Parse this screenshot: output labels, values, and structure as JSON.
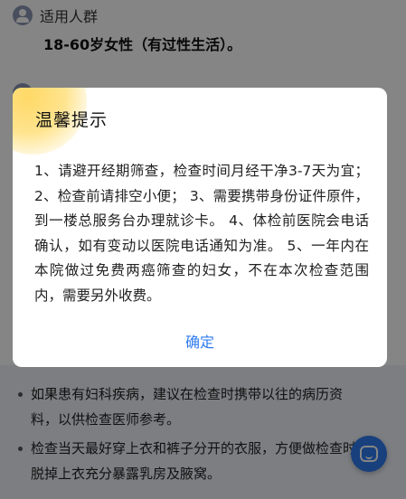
{
  "page": {
    "section_title": "适用人群",
    "target_audience": "18-60岁女性（有过性生活）。",
    "notes": [
      "如果患有妇科疾病，建议在检查时携带以往的病历资料，以供检查医师参考。",
      "检查当天最好穿上衣和裤子分开的衣服，方便做检查时脱掉上衣充分暴露乳房及腋窝。"
    ]
  },
  "dialog": {
    "title": "温馨提示",
    "body": "1、请避开经期筛查，检查时间月经干净3-7天为宜； 2、检查前请排空小便； 3、需要携带身份证件原件，到一楼总服务台办理就诊卡。 4、体检前医院会电话确认，如有变动以医院电话通知为准。 5、一年内在本院做过免费两癌筛查的妇女，不在本次检查范围内，需要另外收费。",
    "confirm_label": "确定"
  },
  "icons": {
    "section": "people-icon",
    "fab": "chat-icon"
  },
  "colors": {
    "accent": "#2f7bf0",
    "mask": "rgba(0,0,0,0.48)",
    "notes_background": "#eef1f8",
    "decoration": "#ffd966"
  }
}
